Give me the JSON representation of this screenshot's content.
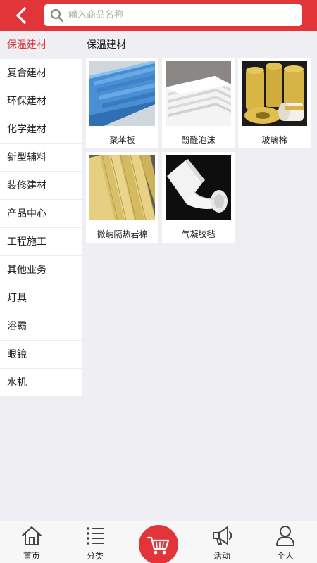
{
  "header": {
    "search_placeholder": "输入商品名称",
    "back_icon": "chevron-left-icon",
    "search_icon": "search-icon"
  },
  "sidebar": {
    "items": [
      {
        "label": "保温建材",
        "active": true
      },
      {
        "label": "复合建材"
      },
      {
        "label": "环保建材"
      },
      {
        "label": "化学建材"
      },
      {
        "label": "新型辅料"
      },
      {
        "label": "装修建材"
      },
      {
        "label": "产品中心"
      },
      {
        "label": "工程施工"
      },
      {
        "label": "其他业务"
      },
      {
        "label": "灯具"
      },
      {
        "label": "浴霸"
      },
      {
        "label": "眼镜"
      },
      {
        "label": "水机"
      }
    ]
  },
  "content": {
    "section_title": "保温建材",
    "products": [
      {
        "name": "聚苯板"
      },
      {
        "name": "酚醛泡沫"
      },
      {
        "name": "玻璃棉"
      },
      {
        "name": "微纳隔热岩棉"
      },
      {
        "name": "气凝胶毡"
      }
    ]
  },
  "tabbar": {
    "items": [
      {
        "label": "首页",
        "icon": "home-icon"
      },
      {
        "label": "分类",
        "icon": "list-icon"
      },
      {
        "label": "活动",
        "icon": "megaphone-icon"
      },
      {
        "label": "个人",
        "icon": "user-icon"
      }
    ],
    "center_icon": "cart-icon"
  },
  "colors": {
    "accent": "#e2353a",
    "background": "#efeef3"
  }
}
